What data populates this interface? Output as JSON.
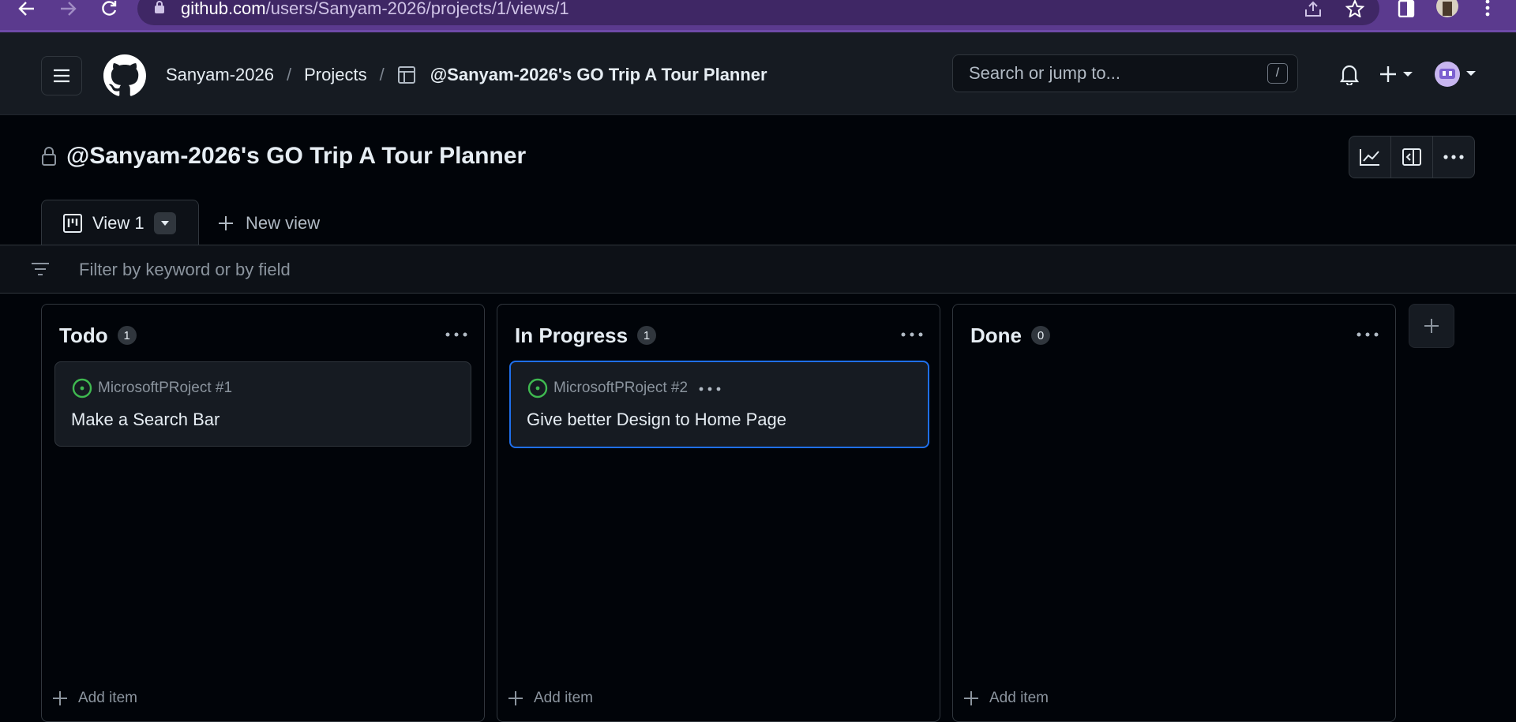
{
  "browser": {
    "url_host": "github.com",
    "url_path": "/users/Sanyam-2026/projects/1/views/1"
  },
  "header": {
    "breadcrumb": {
      "owner": "Sanyam-2026",
      "section": "Projects",
      "project": "@Sanyam-2026's GO Trip A Tour Planner"
    },
    "search": {
      "placeholder": "Search or jump to...",
      "shortcut": "/"
    }
  },
  "project": {
    "title": "@Sanyam-2026's GO Trip A Tour Planner"
  },
  "tabs": {
    "active_label": "View 1",
    "new_view_label": "New view"
  },
  "filter": {
    "placeholder": "Filter by keyword or by field"
  },
  "columns": [
    {
      "title": "Todo",
      "count": "1",
      "cards": [
        {
          "repo": "MicrosoftPRoject #1",
          "title": "Make a Search Bar",
          "status_color": "#3fb950"
        }
      ],
      "add_label": "Add item"
    },
    {
      "title": "In Progress",
      "count": "1",
      "cards": [
        {
          "repo": "MicrosoftPRoject #2",
          "title": "Give better Design to Home Page",
          "status_color": "#3fb950",
          "selected": true
        }
      ],
      "add_label": "Add item"
    },
    {
      "title": "Done",
      "count": "0",
      "cards": [],
      "add_label": "Add item"
    }
  ],
  "colors": {
    "accent_blue": "#1f6feb",
    "open_green": "#3fb950",
    "browser_purple": "#5b3a8e"
  }
}
